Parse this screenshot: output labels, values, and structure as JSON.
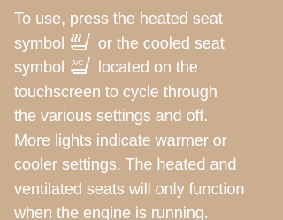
{
  "text": {
    "line1": "To use, press the heated seat",
    "line2_before_icon": "symbol ",
    "line2_after_icon": " or the cooled seat",
    "line3_before_icon": "symbol ",
    "line3_after_icon": " located on the",
    "line4": "touchscreen to cycle through",
    "line5": "the various settings and off.",
    "line6": "More lights indicate warmer or",
    "line7": "cooler settings. The heated and",
    "line8": "ventilated seats will only function",
    "line9": "when the engine is running."
  },
  "icons": {
    "heated_seat": "heated-seat-icon",
    "cooled_seat": "cooled-seat-icon",
    "cooled_seat_label": "A/C"
  },
  "colors": {
    "background": "#cbad8f",
    "text": "#ffffff"
  }
}
